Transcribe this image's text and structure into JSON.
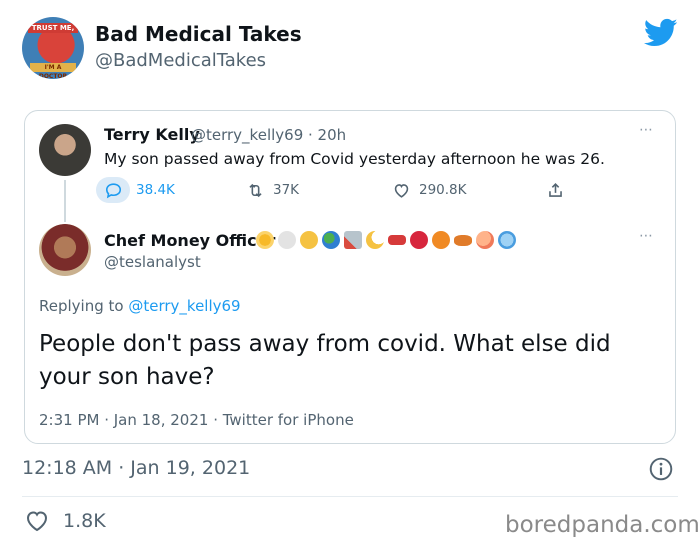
{
  "author": {
    "display_name": "Bad Medical Takes",
    "handle": "@BadMedicalTakes",
    "avatar_badge_top": "TRUST ME,",
    "avatar_badge_bottom": "I'M A DOCTOR"
  },
  "quoted_thread": {
    "parent": {
      "display_name": "Terry Kelly",
      "meta": "@terry_kelly69 · 20h",
      "text": "My son passed away from Covid yesterday afternoon he was 26.",
      "stats": {
        "replies": "38.4K",
        "retweets": "37K",
        "likes": "290.8K"
      },
      "more": "⋯"
    },
    "reply": {
      "display_name": "Chef Money Officer",
      "handle": "@teslanalyst",
      "replying_prefix": "Replying to",
      "replying_to": "@terry_kelly69",
      "text": "People don't pass away from covid. What else did your son have?",
      "meta": "2:31 PM · Jan 18, 2021 · Twitter for iPhone",
      "more": "⋯"
    }
  },
  "footer": {
    "timestamp": "12:18 AM · Jan 19, 2021",
    "likes": "1.8K"
  },
  "watermark": "boredpanda.com",
  "colors": {
    "brand_blue": "#1d9bf0",
    "text_primary": "#0f1419",
    "text_secondary": "#536471",
    "border": "#cfd9de"
  }
}
